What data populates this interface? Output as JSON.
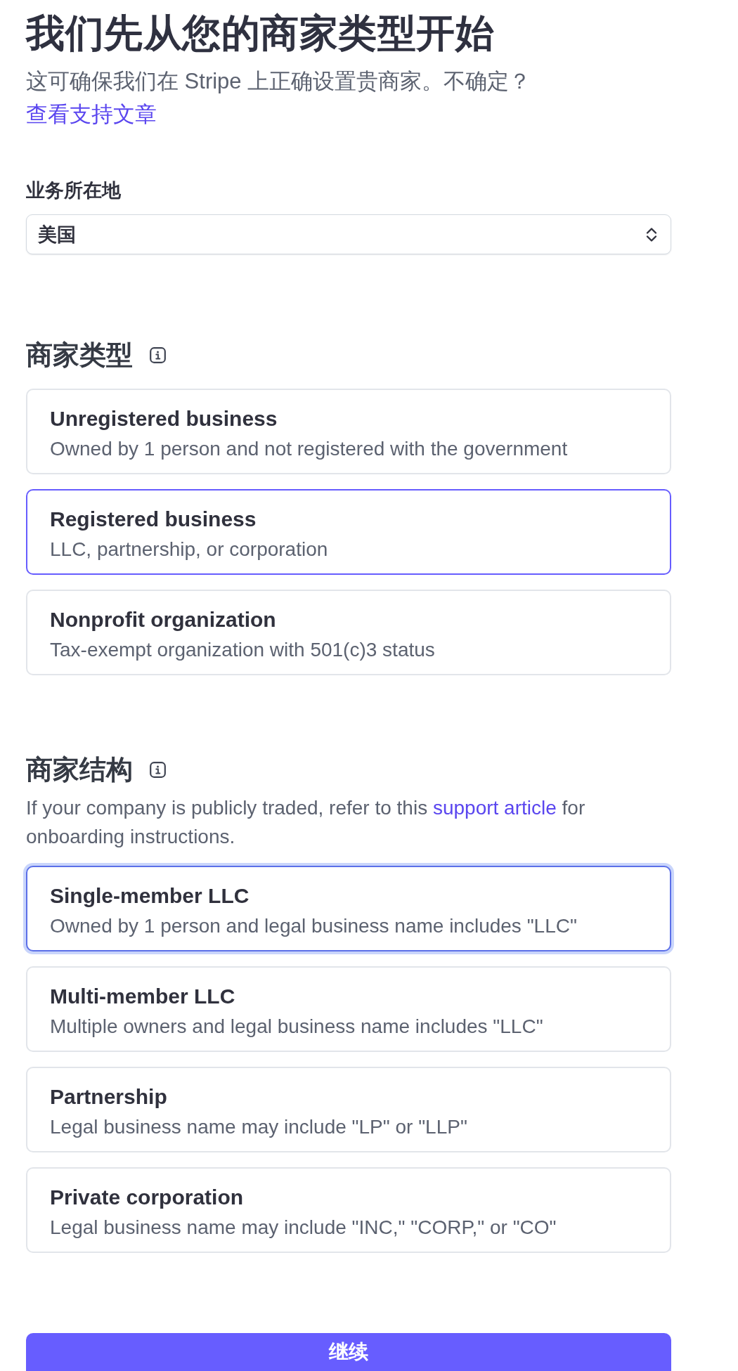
{
  "page": {
    "title": "我们先从您的商家类型开始",
    "subtitle": {
      "text": "这可确保我们在 Stripe 上正确设置贵商家。不确定？",
      "link": "查看支持文章"
    }
  },
  "location_field": {
    "label": "业务所在地",
    "value": "美国"
  },
  "business_type": {
    "heading": "商家类型",
    "options": [
      {
        "title": "Unregistered business",
        "description": "Owned by 1 person and not registered with the government",
        "selected": false,
        "focused": false
      },
      {
        "title": "Registered business",
        "description": "LLC, partnership, or corporation",
        "selected": true,
        "focused": false
      },
      {
        "title": "Nonprofit organization",
        "description": "Tax-exempt organization with 501(c)3 status",
        "selected": false,
        "focused": false
      }
    ]
  },
  "business_structure": {
    "heading": "商家结构",
    "note": {
      "before": "If your company is publicly traded, refer to this ",
      "link": "support article",
      "after": " for onboarding instructions."
    },
    "options": [
      {
        "title": "Single-member LLC",
        "description": "Owned by 1 person and legal business name includes \"LLC\"",
        "selected": true,
        "focused": true
      },
      {
        "title": "Multi-member LLC",
        "description": "Multiple owners and legal business name includes \"LLC\"",
        "selected": false,
        "focused": false
      },
      {
        "title": "Partnership",
        "description": "Legal business name may include \"LP\" or \"LLP\"",
        "selected": false,
        "focused": false
      },
      {
        "title": "Private corporation",
        "description": "Legal business name may include \"INC,\" \"CORP,\" or \"CO\"",
        "selected": false,
        "focused": false
      }
    ]
  },
  "continue_button": {
    "label": "继续"
  }
}
